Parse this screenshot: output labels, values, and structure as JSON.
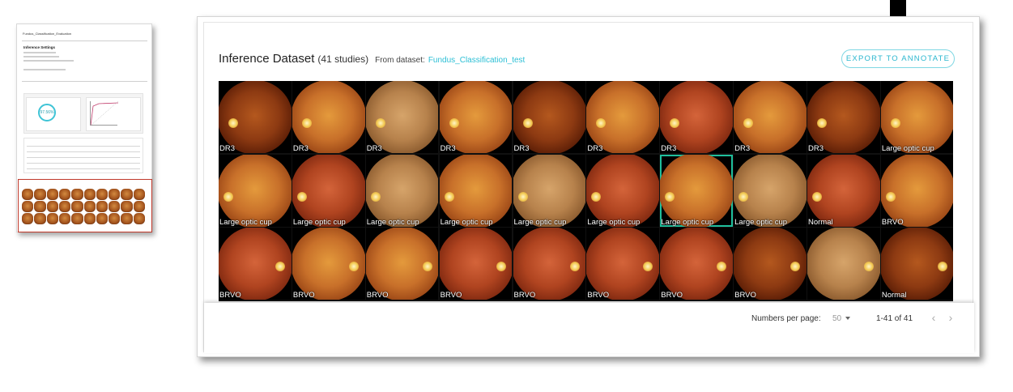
{
  "thumbnail": {
    "title": "Fundus_Classification_Evaluation",
    "settings_heading": "Inference Settings",
    "score": "97.56%"
  },
  "panel": {
    "title": "Inference Dataset",
    "count": "(41 studies)",
    "from_label": "From dataset:",
    "dataset_name": "Fundus_Classification_test",
    "export_label": "EXPORT TO ANNOTATE"
  },
  "images": [
    {
      "label": "DR3",
      "tone": "dark"
    },
    {
      "label": "DR3",
      "tone": "bright"
    },
    {
      "label": "DR3",
      "tone": "pale"
    },
    {
      "label": "DR3",
      "tone": "bright"
    },
    {
      "label": "DR3",
      "tone": "dark"
    },
    {
      "label": "DR3",
      "tone": "bright"
    },
    {
      "label": "DR3",
      "tone": "red"
    },
    {
      "label": "DR3",
      "tone": "bright"
    },
    {
      "label": "DR3",
      "tone": "dark"
    },
    {
      "label": "Large optic cup",
      "tone": "bright"
    },
    {
      "label": "Large optic cup",
      "tone": "bright"
    },
    {
      "label": "Large optic cup",
      "tone": "red"
    },
    {
      "label": "Large optic cup",
      "tone": "pale"
    },
    {
      "label": "Large optic cup",
      "tone": "bright"
    },
    {
      "label": "Large optic cup",
      "tone": "pale"
    },
    {
      "label": "Large optic cup",
      "tone": "red"
    },
    {
      "label": "Large optic cup",
      "tone": "bright",
      "selected": true
    },
    {
      "label": "Large optic cup",
      "tone": "pale"
    },
    {
      "label": "Normal",
      "tone": "red"
    },
    {
      "label": "BRVO",
      "tone": "bright"
    },
    {
      "label": "BRVO",
      "tone": "red"
    },
    {
      "label": "BRVO",
      "tone": "bright"
    },
    {
      "label": "BRVO",
      "tone": "bright"
    },
    {
      "label": "BRVO",
      "tone": "red"
    },
    {
      "label": "BRVO",
      "tone": "red"
    },
    {
      "label": "BRVO",
      "tone": "red"
    },
    {
      "label": "BRVO",
      "tone": "red"
    },
    {
      "label": "BRVO",
      "tone": "dark"
    },
    {
      "label": "",
      "tone": "pale"
    },
    {
      "label": "Normal",
      "tone": "dark"
    }
  ],
  "pagination": {
    "per_page_label": "Numbers per page:",
    "per_page_value": "50",
    "range": "1-41 of 41"
  },
  "colors": {
    "accent": "#2bbfd5",
    "selected_outline": "#1fbf9c",
    "highlight_box": "#c0392b"
  },
  "icons": {
    "arrow": "down-arrow-icon",
    "prev": "chevron-left-icon",
    "next": "chevron-right-icon",
    "dropdown": "caret-down-icon"
  }
}
